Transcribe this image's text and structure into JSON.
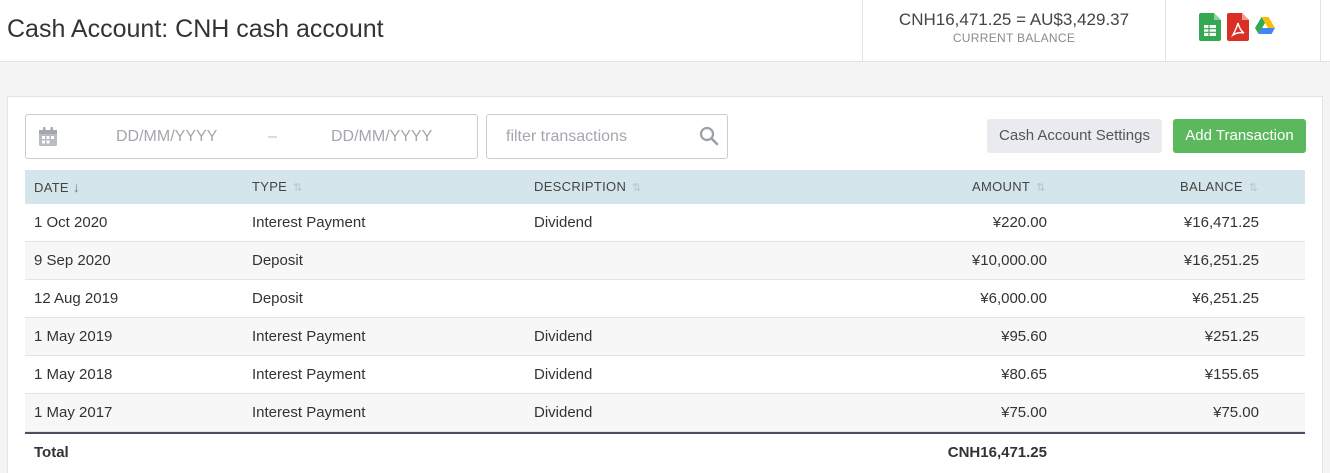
{
  "header": {
    "title": "Cash Account: CNH cash account",
    "balance_amount": "CNH16,471.25 = AU$3,429.37",
    "balance_label": "CURRENT BALANCE",
    "export_icons": [
      "google-sheets-icon",
      "pdf-icon",
      "google-drive-icon"
    ]
  },
  "filters": {
    "date_from_placeholder": "DD/MM/YYYY",
    "date_separator": "–",
    "date_to_placeholder": "DD/MM/YYYY",
    "search_placeholder": "filter transactions"
  },
  "buttons": {
    "settings_label": "Cash Account Settings",
    "add_label": "Add Transaction"
  },
  "table": {
    "columns": [
      "DATE",
      "TYPE",
      "DESCRIPTION",
      "AMOUNT",
      "BALANCE"
    ],
    "rows": [
      {
        "date": "1 Oct 2020",
        "type": "Interest Payment",
        "description": "Dividend",
        "amount": "¥220.00",
        "balance": "¥16,471.25"
      },
      {
        "date": "9 Sep 2020",
        "type": "Deposit",
        "description": "",
        "amount": "¥10,000.00",
        "balance": "¥16,251.25"
      },
      {
        "date": "12 Aug 2019",
        "type": "Deposit",
        "description": "",
        "amount": "¥6,000.00",
        "balance": "¥6,251.25"
      },
      {
        "date": "1 May 2019",
        "type": "Interest Payment",
        "description": "Dividend",
        "amount": "¥95.60",
        "balance": "¥251.25"
      },
      {
        "date": "1 May 2018",
        "type": "Interest Payment",
        "description": "Dividend",
        "amount": "¥80.65",
        "balance": "¥155.65"
      },
      {
        "date": "1 May 2017",
        "type": "Interest Payment",
        "description": "Dividend",
        "amount": "¥75.00",
        "balance": "¥75.00"
      }
    ],
    "total_label": "Total",
    "total_amount": "CNH16,471.25"
  },
  "colors": {
    "accent_green": "#5cb85c",
    "table_header_bg": "#d4e6eb",
    "sheets_green": "#34a853",
    "pdf_red": "#d93025"
  }
}
